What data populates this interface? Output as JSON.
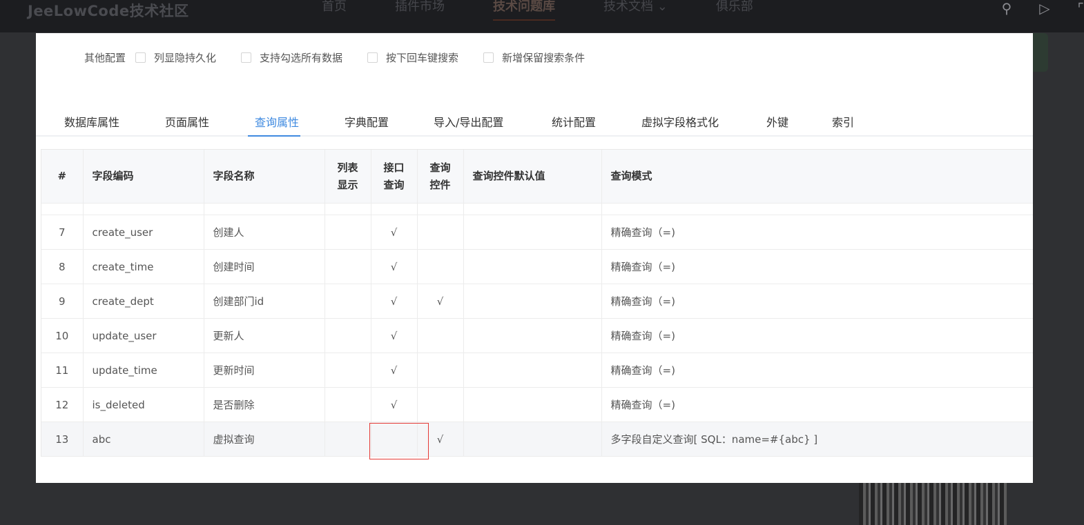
{
  "site": {
    "logo": "JeeLowCode技术社区",
    "nav": [
      "首页",
      "插件市场",
      "技术问题库",
      "技术文档 ⌄",
      "俱乐部"
    ],
    "search_icon": "search-icon",
    "play_icon": "play-icon"
  },
  "other_config": {
    "label": "其他配置",
    "options": [
      "列显隐持久化",
      "支持勾选所有数据",
      "按下回车键搜索",
      "新增保留搜索条件"
    ]
  },
  "tabs": [
    "数据库属性",
    "页面属性",
    "查询属性",
    "字典配置",
    "导入/导出配置",
    "统计配置",
    "虚拟字段格式化",
    "外键",
    "索引"
  ],
  "active_tab": "查询属性",
  "table": {
    "headers": [
      "#",
      "字段编码",
      "字段名称",
      "列表显示",
      "接口查询",
      "查询控件",
      "查询控件默认值",
      "查询模式"
    ],
    "rows": [
      {
        "n": "7",
        "code": "create_user",
        "name": "创建人",
        "list": "",
        "api": "√",
        "ctrl": "",
        "def": "",
        "mode": "精确查询（=)"
      },
      {
        "n": "8",
        "code": "create_time",
        "name": "创建时间",
        "list": "",
        "api": "√",
        "ctrl": "",
        "def": "",
        "mode": "精确查询（=)"
      },
      {
        "n": "9",
        "code": "create_dept",
        "name": "创建部门id",
        "list": "",
        "api": "√",
        "ctrl": "√",
        "def": "",
        "mode": "精确查询（=)"
      },
      {
        "n": "10",
        "code": "update_user",
        "name": "更新人",
        "list": "",
        "api": "√",
        "ctrl": "",
        "def": "",
        "mode": "精确查询（=)"
      },
      {
        "n": "11",
        "code": "update_time",
        "name": "更新时间",
        "list": "",
        "api": "√",
        "ctrl": "",
        "def": "",
        "mode": "精确查询（=)"
      },
      {
        "n": "12",
        "code": "is_deleted",
        "name": "是否删除",
        "list": "",
        "api": "√",
        "ctrl": "",
        "def": "",
        "mode": "精确查询（=)"
      },
      {
        "n": "13",
        "code": "abc",
        "name": "虚拟查询",
        "list": "",
        "api": "",
        "ctrl": "√",
        "def": "",
        "mode": "多字段自定义查询[ SQL：name=#{abc} ]"
      }
    ]
  }
}
